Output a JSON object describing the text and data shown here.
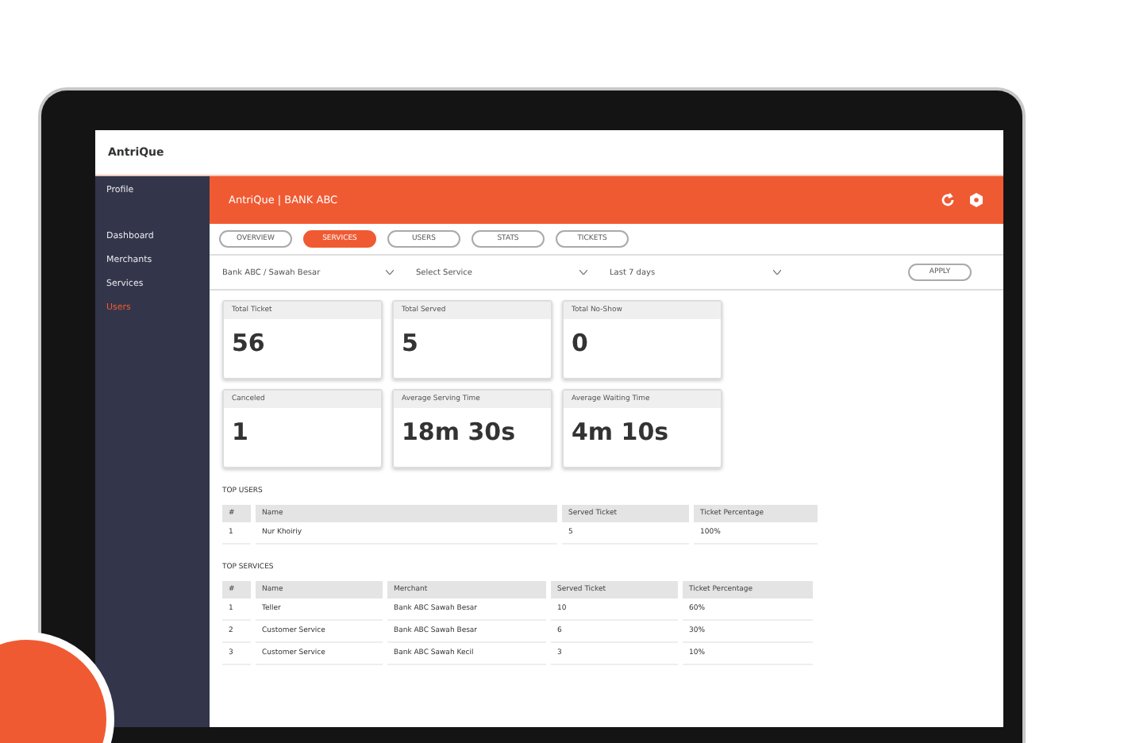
{
  "logo": "AntriQue",
  "sidebar": {
    "items": [
      {
        "label": "Profile",
        "selected": false
      },
      {
        "label": "Dashboard",
        "selected": false
      },
      {
        "label": "Merchants",
        "selected": false
      },
      {
        "label": "Services",
        "selected": false
      },
      {
        "label": "Users",
        "selected": true
      }
    ]
  },
  "header": {
    "title": "AntriQue | BANK ABC"
  },
  "tabs": [
    {
      "label": "OVERVIEW",
      "selected": false
    },
    {
      "label": "SERVICES",
      "selected": true
    },
    {
      "label": "USERS",
      "selected": false
    },
    {
      "label": "STATS",
      "selected": false
    },
    {
      "label": "TICKETS",
      "selected": false
    }
  ],
  "filters": {
    "selects": [
      {
        "value": "Bank ABC / Sawah Besar"
      },
      {
        "value": "Select Service"
      },
      {
        "value": "Last 7 days"
      }
    ],
    "button": "APPLY"
  },
  "stats": [
    {
      "label": "Total Ticket",
      "value": "56"
    },
    {
      "label": "Total Served",
      "value": "5"
    },
    {
      "label": "Total No-Show",
      "value": "0"
    },
    {
      "label": "Canceled",
      "value": "1"
    },
    {
      "label": "Average Serving Time",
      "value": "18m 30s"
    },
    {
      "label": "Average Waiting Time",
      "value": "4m 10s"
    }
  ],
  "top_users": {
    "title": "TOP USERS",
    "columns": [
      "#",
      "Name",
      "Served Ticket",
      "Ticket Percentage"
    ],
    "rows": [
      [
        "1",
        "Nur Khoiriy",
        "5",
        "100%"
      ]
    ]
  },
  "top_services": {
    "title": "TOP SERVICES",
    "columns": [
      "#",
      "Name",
      "Merchant",
      "Served Ticket",
      "Ticket Percentage"
    ],
    "rows": [
      [
        "1",
        "Teller",
        "Bank ABC Sawah Besar",
        "10",
        "60%"
      ],
      [
        "2",
        "Customer Service",
        "Bank ABC Sawah Besar",
        "6",
        "30%"
      ],
      [
        "3",
        "Customer Service",
        "Bank ABC Sawah Kecil",
        "3",
        "10%"
      ]
    ]
  }
}
